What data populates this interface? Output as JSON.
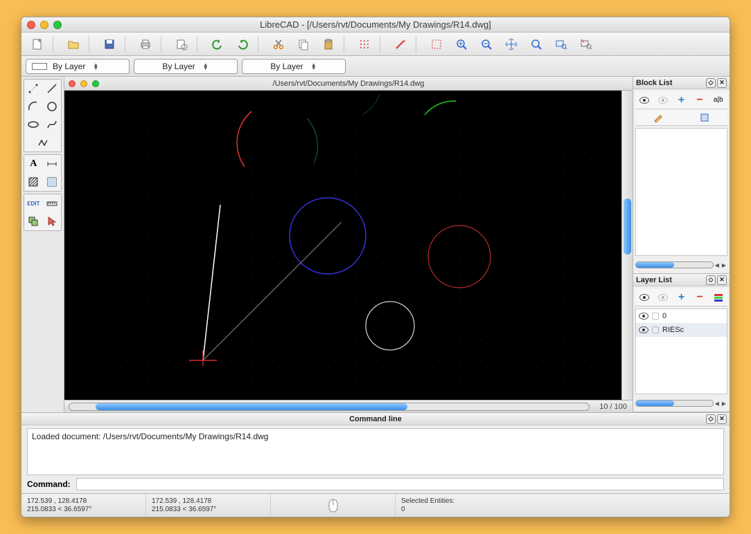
{
  "window": {
    "title": "LibreCAD - [/Users/rvt/Documents/My Drawings/R14.dwg]"
  },
  "document": {
    "title": "/Users/rvt/Documents/My Drawings/R14.dwg"
  },
  "attributes": {
    "linetype": "By Layer",
    "color": "By Layer",
    "width": "By Layer"
  },
  "scrollbar": {
    "label": "10 / 100"
  },
  "panels": {
    "block": {
      "title": "Block List"
    },
    "layer": {
      "title": "Layer List",
      "layers": [
        {
          "name": "0",
          "visible": true
        },
        {
          "name": "RIESc",
          "visible": true
        }
      ]
    }
  },
  "commandline": {
    "title": "Command line",
    "log": "Loaded document: /Users/rvt/Documents/My Drawings/R14.dwg",
    "prompt": "Command:"
  },
  "status": {
    "coord1_abs": "172.539 , 128.4178",
    "coord1_pol": "215.0833 < 36.6597°",
    "coord2_abs": "172.539 , 128.4178",
    "coord2_pol": "215.0833 < 36.6597°",
    "selected_label": "Selected Entities:",
    "selected_count": "0"
  },
  "icons": {
    "plus": "+",
    "minus": "−",
    "ab": "a|b"
  },
  "colors": {
    "accent": "#3a8ee6"
  }
}
